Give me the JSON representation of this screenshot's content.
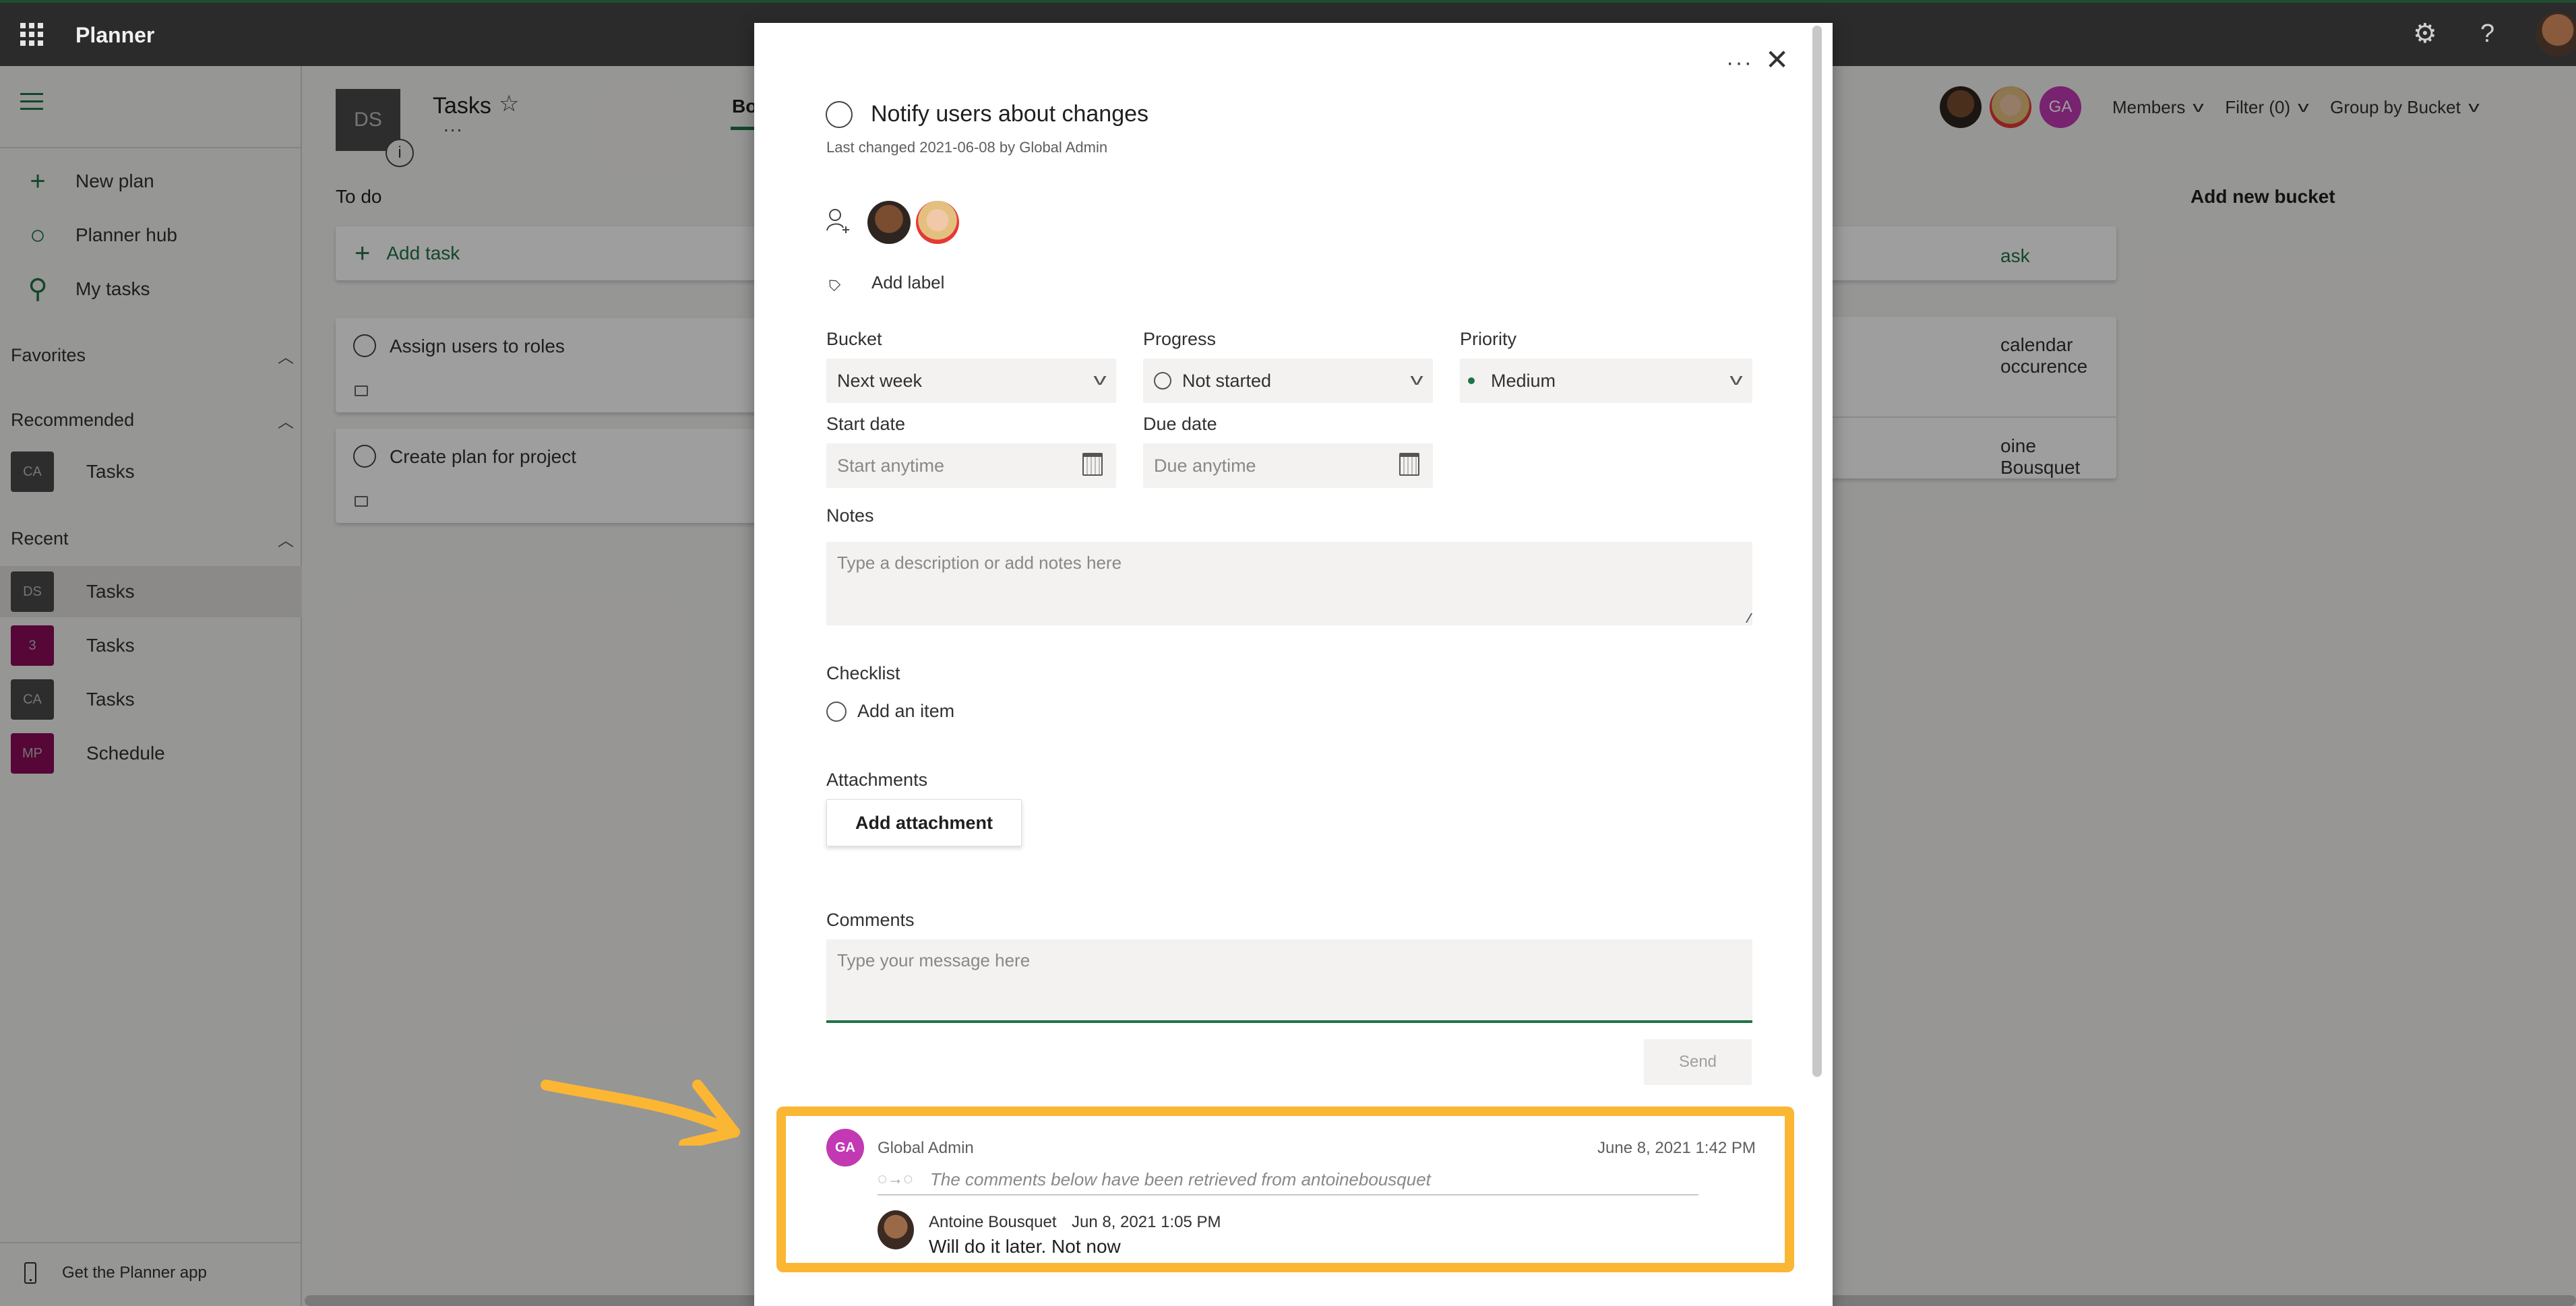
{
  "app": {
    "title": "Planner",
    "header_icons": [
      "waffle-icon",
      "settings-icon",
      "help-icon",
      "user-avatar"
    ]
  },
  "sidebar": {
    "nav": [
      {
        "icon": "plus-icon",
        "label": "New plan"
      },
      {
        "icon": "hub-icon",
        "label": "Planner hub"
      },
      {
        "icon": "person-icon",
        "label": "My tasks"
      }
    ],
    "favorites_label": "Favorites",
    "recommended_label": "Recommended",
    "recommended": [
      {
        "initials": "CA",
        "label": "Tasks",
        "color": "#4a4a4a"
      }
    ],
    "recent_label": "Recent",
    "recent": [
      {
        "initials": "DS",
        "label": "Tasks",
        "color": "#4a4a4a",
        "active": true
      },
      {
        "initials": "3",
        "label": "Tasks",
        "color": "#8b0a5a"
      },
      {
        "initials": "CA",
        "label": "Tasks",
        "color": "#4a4a4a"
      },
      {
        "initials": "MP",
        "label": "Schedule",
        "color": "#8b0a5a"
      }
    ],
    "get_app": "Get the Planner app"
  },
  "board": {
    "plan_initials": "DS",
    "plan_name": "Tasks",
    "tab_board": "Bo",
    "more": "...",
    "members_label": "Members",
    "filter_label": "Filter (0)",
    "group_label": "Group by Bucket",
    "member_initials": "GA",
    "buckets": [
      {
        "name": "To do",
        "add_task": "Add task",
        "tasks": [
          "Assign users to roles",
          "Create plan for project"
        ]
      }
    ],
    "partial_bucket": {
      "add_task_fragment": "ask",
      "task_fragment": "calendar occurence",
      "assignee_fragment": "oine Bousquet"
    },
    "add_new_bucket": "Add new bucket"
  },
  "task_modal": {
    "title": "Notify users about changes",
    "last_changed": "Last changed 2021-06-08 by Global Admin",
    "add_label": "Add label",
    "fields": {
      "bucket": {
        "label": "Bucket",
        "value": "Next week"
      },
      "progress": {
        "label": "Progress",
        "value": "Not started"
      },
      "priority": {
        "label": "Priority",
        "value": "Medium",
        "color": "#217346"
      },
      "start_date": {
        "label": "Start date",
        "placeholder": "Start anytime"
      },
      "due_date": {
        "label": "Due date",
        "placeholder": "Due anytime"
      }
    },
    "notes": {
      "label": "Notes",
      "placeholder": "Type a description or add notes here"
    },
    "checklist": {
      "label": "Checklist",
      "add_item": "Add an item"
    },
    "attachments": {
      "label": "Attachments",
      "button": "Add attachment"
    },
    "comments": {
      "label": "Comments",
      "placeholder": "Type your message here",
      "send": "Send",
      "items": [
        {
          "author_initials": "GA",
          "author": "Global Admin",
          "date": "June 8, 2021 1:42 PM",
          "migrated_note": "The comments below have been retrieved from antoinebousquet",
          "replies": [
            {
              "author": "Antoine Bousquet",
              "date": "Jun 8, 2021 1:05 PM",
              "text": "Will do it later. Not now"
            }
          ]
        }
      ]
    }
  },
  "annotation": {
    "color": "#fbb634"
  }
}
